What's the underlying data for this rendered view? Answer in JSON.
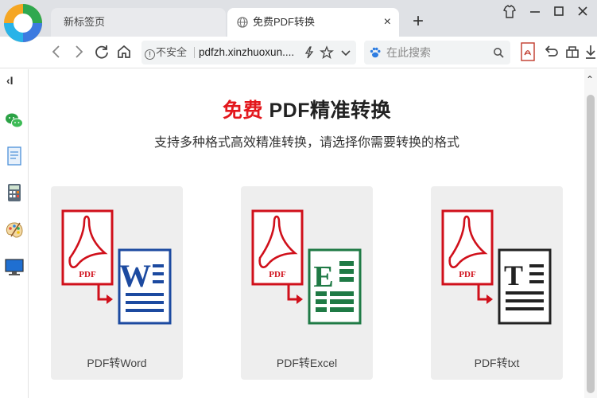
{
  "browser": {
    "tabs": [
      {
        "title": "新标签页",
        "active": false
      },
      {
        "title": "免费PDF转换",
        "active": true
      }
    ],
    "new_tab_symbol": "+",
    "close_tab_symbol": "×",
    "window_controls": [
      "shirt-icon",
      "minimize-icon",
      "maximize-icon",
      "close-icon"
    ],
    "nav_icons": [
      "back-icon",
      "forward-icon",
      "refresh-icon",
      "home-icon"
    ],
    "address_bar": {
      "security_label": "不安全",
      "url": "pdfzh.xinzhuoxun....",
      "icons": [
        "lightning-icon",
        "star-icon",
        "dropdown-icon"
      ]
    },
    "search_box": {
      "placeholder": "在此搜索",
      "icons": [
        "paw-icon",
        "magnifier-icon"
      ]
    },
    "toolbar_right_icons": [
      "pdf-icon",
      "undo-icon",
      "store-icon",
      "download-icon"
    ],
    "sidebar": {
      "collapse_symbol": "‹I",
      "icons": [
        "wechat-icon",
        "document-icon",
        "calculator-icon",
        "paint-palette-icon",
        "monitor-icon"
      ]
    }
  },
  "page": {
    "heading_accent": "免费",
    "heading_rest": " PDF精准转换",
    "subheading": "支持多种格式高效精准转换，请选择你需要转换的格式",
    "cards": [
      {
        "caption": "PDF转Word",
        "badge_letter": "W",
        "badge_color": "#1c4aa0"
      },
      {
        "caption": "PDF转Excel",
        "badge_letter": "E",
        "badge_color": "#1f7a45"
      },
      {
        "caption": "PDF转txt",
        "badge_letter": "T",
        "badge_color": "#222222"
      }
    ],
    "pdf_label": "PDF",
    "colors": {
      "accent_red": "#e3171c",
      "card_bg": "#eeeeee"
    }
  },
  "scrollbar": {
    "up_symbol": "⌃"
  }
}
